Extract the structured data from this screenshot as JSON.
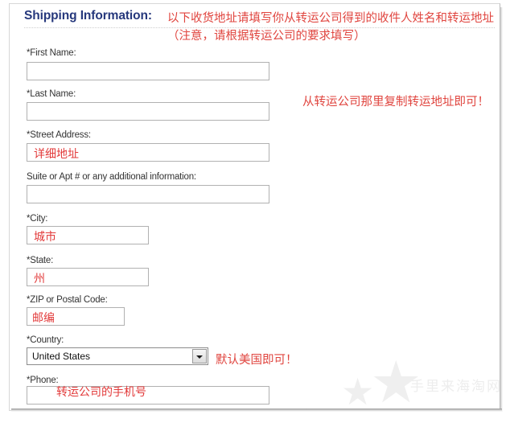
{
  "heading": "Shipping Information:",
  "form": {
    "fields": [
      {
        "label": "*First Name:",
        "value": ""
      },
      {
        "label": "*Last Name:",
        "value": ""
      },
      {
        "label": "*Street Address:",
        "value": "详细地址"
      },
      {
        "label": "Suite or Apt # or any additional information:",
        "value": ""
      },
      {
        "label": "*City:",
        "value": "城市"
      },
      {
        "label": "*State:",
        "value": "州"
      },
      {
        "label": "*ZIP or Postal Code:",
        "value": "邮编"
      },
      {
        "label": "*Country:",
        "value": "United States"
      },
      {
        "label": "*Phone:",
        "value": "转运公司的手机号"
      }
    ]
  },
  "annotations": {
    "top": "以下收货地址请填写你从转运公司得到的收件人姓名和转运地址（注意，请根据转运公司的要求填写）",
    "street": "从转运公司那里复制转运地址即可！",
    "country": "默认美国即可！"
  },
  "watermark": {
    "text": "手里来海淘网",
    "star_glyph": "★"
  },
  "icons": {
    "dropdown_arrow": "chevron-down-icon"
  },
  "colors": {
    "heading": "#26387c",
    "annotation_red": "#e0453f",
    "label": "#333333",
    "input_border": "#b1b1b1"
  }
}
